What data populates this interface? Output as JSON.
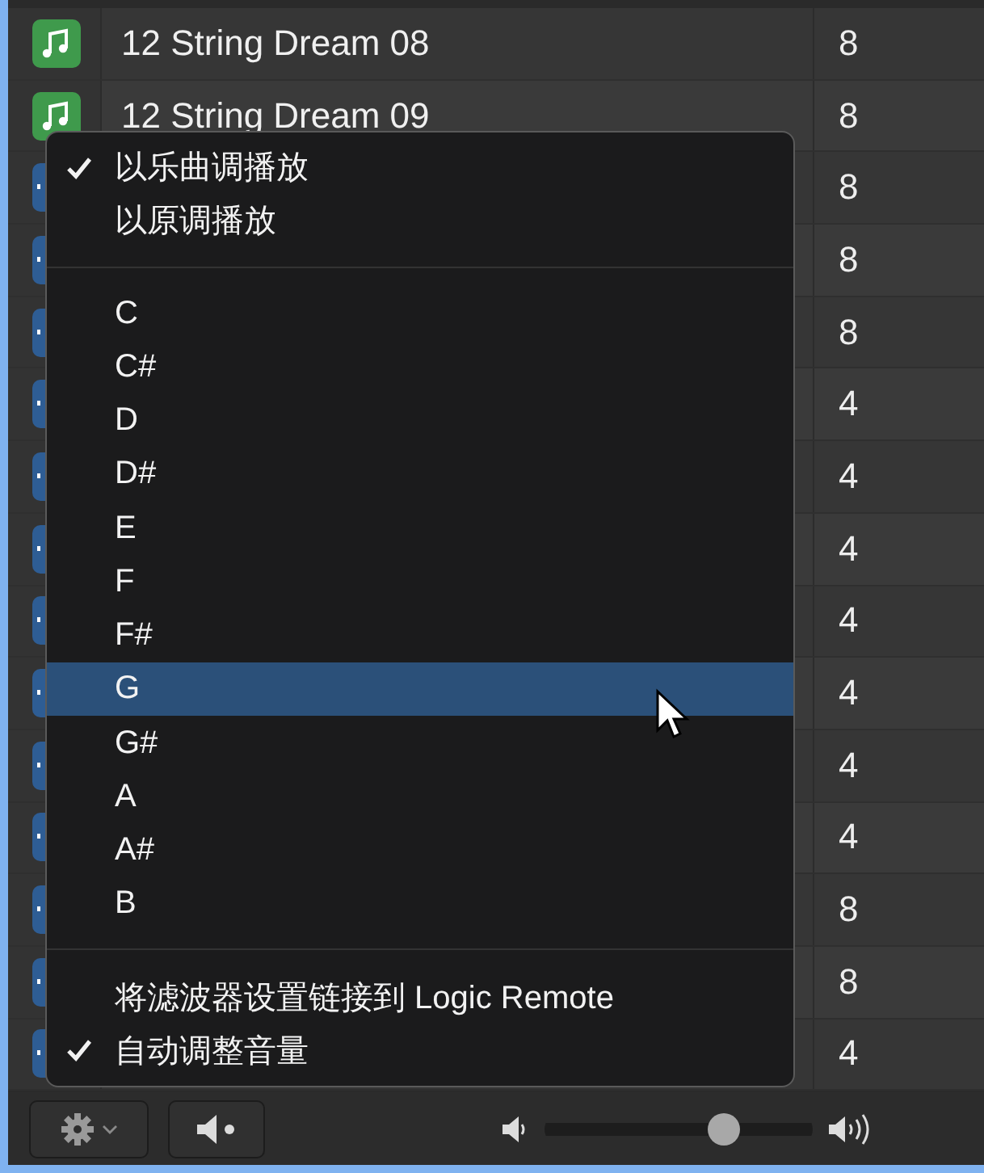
{
  "rows": [
    {
      "kind": "audio",
      "title": "12 String Dream 08",
      "count": "8"
    },
    {
      "kind": "audio",
      "title": "12 String Dream 09",
      "count": "8"
    },
    {
      "kind": "loop",
      "count": "8"
    },
    {
      "kind": "loop",
      "count": "8"
    },
    {
      "kind": "loop",
      "count": "8"
    },
    {
      "kind": "loop",
      "count": "4"
    },
    {
      "kind": "loop",
      "count": "4"
    },
    {
      "kind": "loop",
      "count": "4"
    },
    {
      "kind": "loop",
      "count": "4"
    },
    {
      "kind": "loop",
      "count": "4"
    },
    {
      "kind": "loop",
      "count": "4"
    },
    {
      "kind": "loop",
      "count": "4"
    },
    {
      "kind": "loop",
      "count": "8"
    },
    {
      "kind": "loop",
      "count": "8"
    },
    {
      "kind": "loop",
      "count": "4"
    }
  ],
  "menu": {
    "sections": [
      [
        {
          "label": "以乐曲调播放",
          "checked": true,
          "selected": false
        },
        {
          "label": "以原调播放",
          "checked": false,
          "selected": false
        }
      ],
      [
        {
          "label": "C",
          "checked": false,
          "selected": false
        },
        {
          "label": "C#",
          "checked": false,
          "selected": false
        },
        {
          "label": "D",
          "checked": false,
          "selected": false
        },
        {
          "label": "D#",
          "checked": false,
          "selected": false
        },
        {
          "label": "E",
          "checked": false,
          "selected": false
        },
        {
          "label": "F",
          "checked": false,
          "selected": false
        },
        {
          "label": "F#",
          "checked": false,
          "selected": false
        },
        {
          "label": "G",
          "checked": false,
          "selected": true
        },
        {
          "label": "G#",
          "checked": false,
          "selected": false
        },
        {
          "label": "A",
          "checked": false,
          "selected": false
        },
        {
          "label": "A#",
          "checked": false,
          "selected": false
        },
        {
          "label": "B",
          "checked": false,
          "selected": false
        }
      ],
      [
        {
          "label": "将滤波器设置链接到 Logic Remote",
          "checked": false,
          "selected": false
        },
        {
          "label": "自动调整音量",
          "checked": true,
          "selected": false
        }
      ]
    ]
  },
  "volume": {
    "level": 0.67
  }
}
